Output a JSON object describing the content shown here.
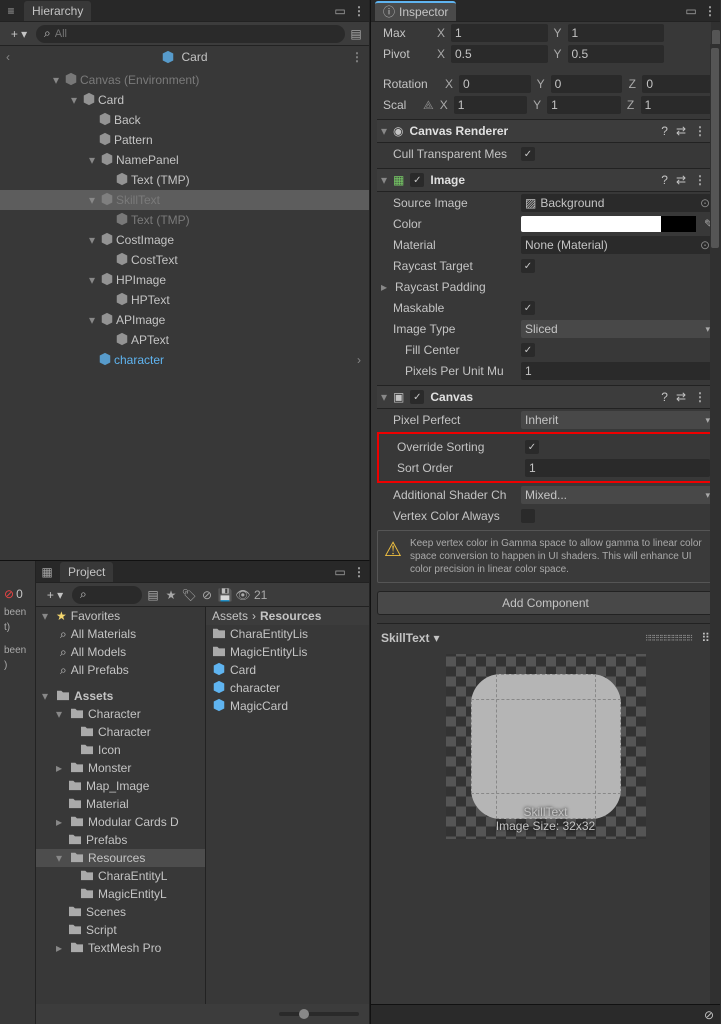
{
  "hierarchy": {
    "tab": "Hierarchy",
    "searchPlaceholder": "All",
    "breadcrumb": "Card",
    "tree": {
      "canvas": "Canvas (Environment)",
      "card": "Card",
      "back": "Back",
      "pattern": "Pattern",
      "namepanel": "NamePanel",
      "text_tmp1": "Text (TMP)",
      "skilltext": "SkillText",
      "text_tmp2": "Text (TMP)",
      "costimage": "CostImage",
      "costtext": "CostText",
      "hpimage": "HPImage",
      "hptext": "HPText",
      "apimage": "APImage",
      "aptext": "APText",
      "character": "character"
    }
  },
  "project": {
    "tab": "Project",
    "visibility": "21",
    "favorites": "Favorites",
    "all_materials": "All Materials",
    "all_models": "All Models",
    "all_prefabs": "All Prefabs",
    "assets": "Assets",
    "folders": {
      "character": "Character",
      "character2": "Character",
      "icon": "Icon",
      "monster": "Monster",
      "map_image": "Map_Image",
      "material": "Material",
      "modular": "Modular Cards D",
      "prefabs": "Prefabs",
      "resources": "Resources",
      "charaentityl": "CharaEntityL",
      "magicentityl": "MagicEntityL",
      "scenes": "Scenes",
      "script": "Script",
      "textmesh": "TextMesh Pro"
    },
    "breadcrumb1": "Assets",
    "breadcrumb2": "Resources",
    "items": {
      "charaentitylis": "CharaEntityLis",
      "magicentitylis": "MagicEntityLis",
      "card": "Card",
      "character": "character",
      "magiccard": "MagicCard"
    }
  },
  "leftstrip": {
    "err": "0",
    "been": "been",
    "t": "t)",
    "been2": "been",
    "t2": ")"
  },
  "inspector": {
    "tab": "Inspector",
    "transform": {
      "max": "Max",
      "maxX": "1",
      "maxY": "1",
      "pivot": "Pivot",
      "pivX": "0.5",
      "pivY": "0.5",
      "rotation": "Rotation",
      "rotX": "0",
      "rotY": "0",
      "rotZ": "0",
      "scale": "Scal",
      "sclX": "1",
      "sclY": "1",
      "sclZ": "1",
      "X": "X",
      "Y": "Y",
      "Z": "Z"
    },
    "canvasRenderer": {
      "title": "Canvas Renderer",
      "cull": "Cull Transparent Mes"
    },
    "image": {
      "title": "Image",
      "source": "Source Image",
      "sourceVal": "Background",
      "color": "Color",
      "material": "Material",
      "materialVal": "None (Material)",
      "raycast": "Raycast Target",
      "padding": "Raycast Padding",
      "maskable": "Maskable",
      "type": "Image Type",
      "typeVal": "Sliced",
      "fill": "Fill Center",
      "ppu": "Pixels Per Unit Mu",
      "ppuVal": "1"
    },
    "canvas": {
      "title": "Canvas",
      "pixel": "Pixel Perfect",
      "pixelVal": "Inherit",
      "override": "Override Sorting",
      "sort": "Sort Order",
      "sortVal": "1",
      "shader": "Additional Shader Ch",
      "shaderVal": "Mixed...",
      "vcolor": "Vertex Color Always",
      "warn": "Keep vertex color in Gamma space to allow gamma to linear color space conversion to happen in UI shaders. This will enhance UI color precision in linear color space."
    },
    "addComponent": "Add Component",
    "preview": {
      "title": "SkillText",
      "label1": "SkillText",
      "label2": "Image Size: 32x32"
    }
  }
}
